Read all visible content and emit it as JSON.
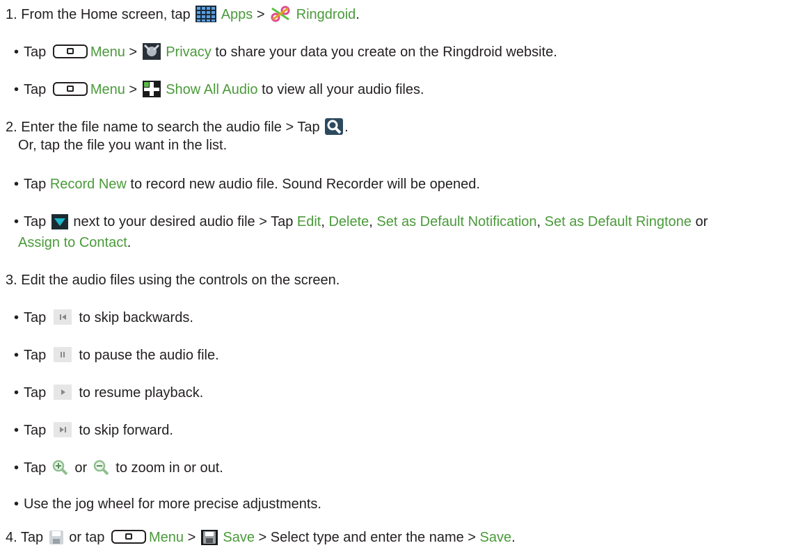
{
  "step1": {
    "num": "1.",
    "text_a": "From the Home screen, tap",
    "apps": "Apps",
    "gt": ">",
    "ringdroid": "Ringdroid",
    "end": "."
  },
  "bullet": "•",
  "s1a": {
    "tap": "Tap",
    "menu": "Menu",
    "gt": ">",
    "privacy": "Privacy",
    "rest": "to share your data you create on the Ringdroid website."
  },
  "s1b": {
    "tap": "Tap",
    "menu": "Menu",
    "gt": ">",
    "show_all": "Show All Audio",
    "rest": "to view all your audio files."
  },
  "step2": {
    "num": "2.",
    "text_a": "Enter the file name to search the audio file > Tap",
    "end": ".",
    "line2": "Or, tap the file you want in the list."
  },
  "s2a": {
    "tap": "Tap",
    "record_new": "Record New",
    "rest": "to record new audio file. Sound Recorder will be opened."
  },
  "s2b": {
    "tap": "Tap",
    "mid": "next to your desired audio file > Tap",
    "edit": "Edit",
    "comma1": ",",
    "delete": "Delete",
    "comma2": ",",
    "set_notif": "Set as Default Notification",
    "comma3": ",",
    "set_ring": "Set as Default Ringtone",
    "or": "or",
    "assign": "Assign to Contact",
    "end": "."
  },
  "step3": {
    "num": "3.",
    "text": "Edit the audio files using the controls on the screen."
  },
  "s3a": {
    "tap": "Tap",
    "rest": "to skip backwards."
  },
  "s3b": {
    "tap": "Tap",
    "rest": "to pause the audio file."
  },
  "s3c": {
    "tap": "Tap",
    "rest": "to resume playback."
  },
  "s3d": {
    "tap": "Tap",
    "rest": "to skip forward."
  },
  "s3e": {
    "tap": "Tap",
    "or": "or",
    "rest": "to zoom in or out."
  },
  "s3f": {
    "text": "Use the jog wheel for more precise adjustments."
  },
  "step4": {
    "num": "4.",
    "tap": "Tap",
    "or_tap": "or tap",
    "menu": "Menu",
    "gt": ">",
    "save": "Save",
    "mid": "> Select type and enter the name >",
    "save2": "Save",
    "end": "."
  },
  "colors": {
    "link_green": "#4a9a3a",
    "text": "#231f20",
    "search_icon_bg": "#2c4a5e",
    "arrow_teal": "#1bb6c9"
  },
  "icons": [
    "apps-grid-icon",
    "ringdroid-icon",
    "menu-key-icon",
    "privacy-icon",
    "show-all-audio-icon",
    "search-icon",
    "dropdown-arrow-icon",
    "skip-backward-icon",
    "pause-icon",
    "play-icon",
    "skip-forward-icon",
    "zoom-in-icon",
    "zoom-out-icon",
    "save-icon"
  ]
}
